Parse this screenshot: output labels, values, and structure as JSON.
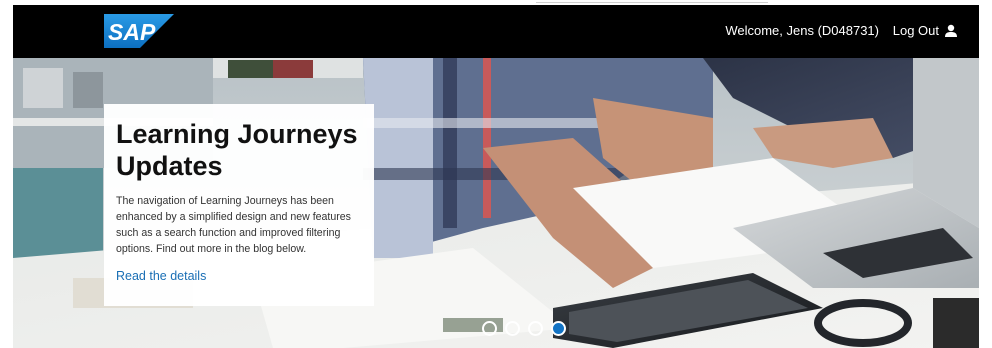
{
  "header": {
    "logo_text": "SAP",
    "welcome": "Welcome, Jens (D048731)",
    "logout_label": "Log Out",
    "logout_icon": "user-icon"
  },
  "hero": {
    "title": "Learning Journeys Updates",
    "body": "The navigation of Learning Journeys has been enhanced by a simplified design and new features such as a search function and improved filtering options. Find out more in the blog below.",
    "link_label": "Read the details",
    "slides_total": 4,
    "active_slide": 4
  },
  "colors": {
    "header_bg": "#000000",
    "logo_blue": "#1e88d9",
    "link_blue": "#1a6fb5",
    "active_dot": "#1273c4"
  }
}
